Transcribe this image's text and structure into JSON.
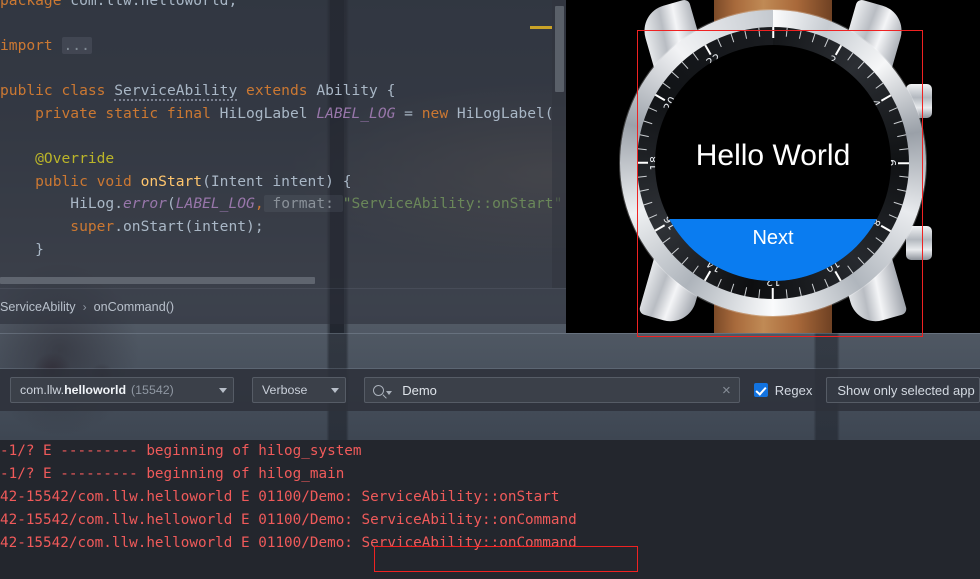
{
  "editor": {
    "code_lines": [
      {
        "id": "l1",
        "segments": [
          {
            "t": "package ",
            "c": "kw"
          },
          {
            "t": "com.llw.helloworld;",
            "c": "plain"
          }
        ]
      },
      {
        "id": "l2",
        "segments": []
      },
      {
        "id": "l3",
        "segments": [
          {
            "t": "import ",
            "c": "kw"
          },
          {
            "t": "...",
            "c": "fold"
          }
        ]
      },
      {
        "id": "l4",
        "segments": []
      },
      {
        "id": "l5",
        "segments": [
          {
            "t": "public class ",
            "c": "kw"
          },
          {
            "t": "ServiceAbility",
            "c": "typo"
          },
          {
            "t": " extends ",
            "c": "kw"
          },
          {
            "t": "Ability {",
            "c": "plain"
          }
        ]
      },
      {
        "id": "l6",
        "segments": [
          {
            "t": "    private static final ",
            "c": "kw"
          },
          {
            "t": "HiLogLabel ",
            "c": "plain"
          },
          {
            "t": "LABEL_LOG",
            "c": "field"
          },
          {
            "t": " = ",
            "c": "plain"
          },
          {
            "t": "new ",
            "c": "kw"
          },
          {
            "t": "HiLogLabel(",
            "c": "plain"
          }
        ]
      },
      {
        "id": "l7",
        "segments": []
      },
      {
        "id": "l8",
        "segments": [
          {
            "t": "    @Override",
            "c": "ann"
          }
        ]
      },
      {
        "id": "l9",
        "segments": [
          {
            "t": "    public void ",
            "c": "kw"
          },
          {
            "t": "onStart",
            "c": "method"
          },
          {
            "t": "(Intent intent) {",
            "c": "plain"
          }
        ]
      },
      {
        "id": "l10",
        "segments": [
          {
            "t": "        HiLog.",
            "c": "plain"
          },
          {
            "t": "error",
            "c": "field"
          },
          {
            "t": "(",
            "c": "plain"
          },
          {
            "t": "LABEL_LOG",
            "c": "field"
          },
          {
            "t": ",",
            "c": "kw"
          },
          {
            "t": " format: ",
            "c": "hint"
          },
          {
            "t": "\"ServiceAbility::onStart\"",
            "c": "str"
          }
        ]
      },
      {
        "id": "l11",
        "segments": [
          {
            "t": "        super",
            "c": "kw"
          },
          {
            "t": ".onStart(intent);",
            "c": "plain"
          }
        ]
      },
      {
        "id": "l12",
        "segments": [
          {
            "t": "    }",
            "c": "plain"
          }
        ]
      }
    ],
    "breadcrumb": {
      "class_name": "ServiceAbility",
      "separator": "›",
      "method_name": "onCommand()"
    }
  },
  "emulator": {
    "device": "smart-watch",
    "screen": {
      "title": "Hello World",
      "button_label": "Next",
      "button_color": "#0a7cf0",
      "background": "#000000"
    },
    "bezel_numbers": [
      "2",
      "4",
      "6",
      "8",
      "10",
      "12",
      "14",
      "16",
      "18",
      "20",
      "22"
    ],
    "annotation": {
      "type": "red-rectangle",
      "color": "#ef2222"
    }
  },
  "logcat": {
    "process_selector": {
      "package_prefix": "com.llw.",
      "package_bold": "helloworld",
      "pid": "(15542)"
    },
    "level_selector": {
      "value": "Verbose"
    },
    "search": {
      "value": "Demo",
      "placeholder": "Search",
      "clear_label": "×"
    },
    "regex": {
      "label": "Regex",
      "checked": true,
      "accent": "#1273e0"
    },
    "scope_selector": {
      "value": "Show only selected app"
    },
    "log_color": "#f05a5a",
    "lines": [
      "-1/? E --------- beginning of hilog_system",
      "-1/? E --------- beginning of hilog_main",
      "42-15542/com.llw.helloworld E 01100/Demo: ServiceAbility::onStart",
      "42-15542/com.llw.helloworld E 01100/Demo: ServiceAbility::onCommand",
      "42-15542/com.llw.helloworld E 01100/Demo: ServiceAbility::onCommand"
    ],
    "highlight": {
      "text": "ServiceAbility::onCommand",
      "color": "#ef2222"
    }
  }
}
